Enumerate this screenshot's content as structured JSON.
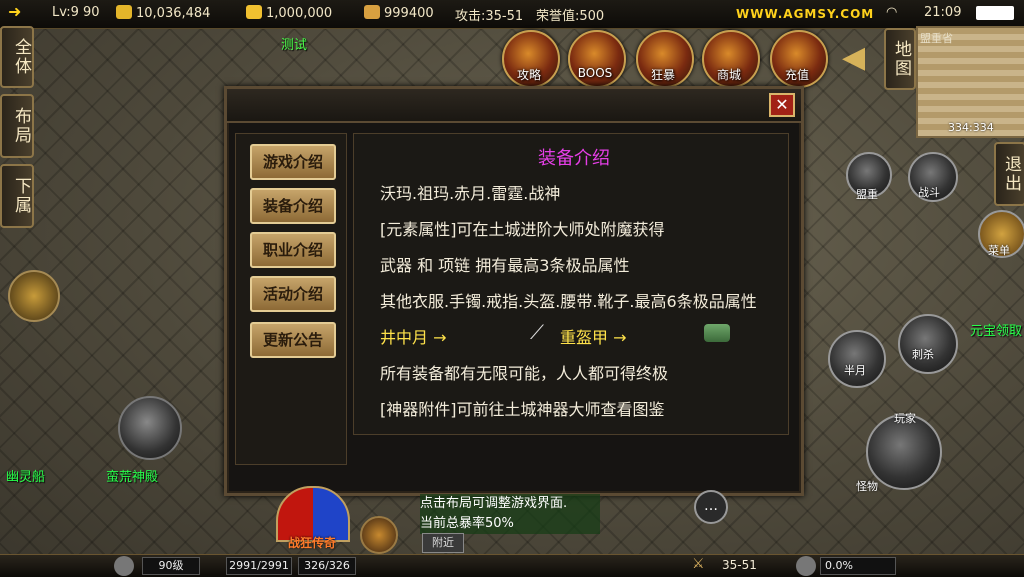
{
  "topbar": {
    "level": "Lv:9 90",
    "gold": "10,036,484",
    "ingot": "1,000,000",
    "points": "999400",
    "attack": "攻击:35-51",
    "honor": "荣誉值:500",
    "site": "WWW.AGMSY.COM",
    "time": "21:09"
  },
  "player_name": "测试",
  "left_buttons": [
    "全体",
    "布局",
    "下属"
  ],
  "top_icons": [
    "攻略",
    "BOOS",
    "狂暴",
    "商城",
    "充值"
  ],
  "right_buttons": {
    "map": "地图",
    "exit": "退出"
  },
  "minimap": {
    "area": "盟重省",
    "coords": "334:334"
  },
  "dialog": {
    "menu": [
      "游戏介绍",
      "装备介绍",
      "职业介绍",
      "活动介绍",
      "更新公告"
    ],
    "title": "装备介绍",
    "lines": [
      "沃玛.祖玛.赤月.雷霆.战神",
      "[元素属性]可在土城进阶大师处附魔获得",
      "武器 和 项链 拥有最高3条极品属性",
      "其他衣服.手镯.戒指.头盔.腰带.靴子.最高6条极品属性"
    ],
    "item1": "井中月 →",
    "item2": "重盔甲 →",
    "lines2": [
      "所有装备都有无限可能，人人都可得终极",
      "[神器附件]可前往土城神器大师查看图鉴"
    ],
    "close": "✕"
  },
  "world": {
    "npc_left1": "幽灵船",
    "npc_left2": "蛮荒神殿",
    "npc_right": "元宝领取",
    "skills": [
      "战斗",
      "盟重",
      "菜单",
      "刺杀",
      "半月",
      "玩家",
      "怪物"
    ]
  },
  "bottom": {
    "tip1": "点击布局可调整游戏界面.",
    "tip2": "当前总暴率50%",
    "nearby": "附近",
    "brand": "战狂传奇",
    "level": "90级",
    "hp": "2991/2991",
    "mp": "326/326",
    "attack": "35-51",
    "exp": "0.0%"
  }
}
